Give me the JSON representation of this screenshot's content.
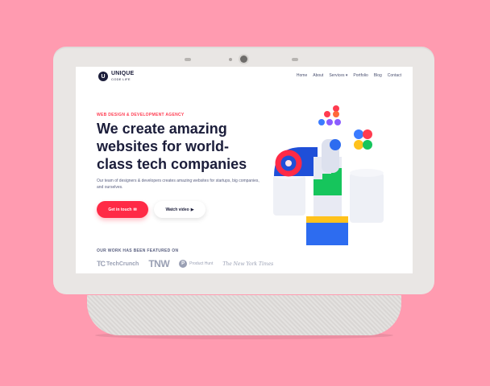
{
  "site": {
    "logo": {
      "mark": "U",
      "line1": "UNIQUE",
      "line2": "CODE LIFE"
    },
    "nav": [
      {
        "label": "Home"
      },
      {
        "label": "About"
      },
      {
        "label": "Services ▾"
      },
      {
        "label": "Portfolio"
      },
      {
        "label": "Blog"
      },
      {
        "label": "Contact"
      }
    ]
  },
  "hero": {
    "eyebrow": "WEB DESIGN & DEVELOPMENT AGENCY",
    "headline": "We create amazing websites for world-class tech companies",
    "subtext": "Our team of designers & developers creates amazing websites for startups, big companies, and ourselves.",
    "primary_button": "Get in touch",
    "primary_button_icon": "✉",
    "secondary_button": "Watch video",
    "secondary_button_icon": "▶"
  },
  "featured": {
    "label": "OUR WORK HAS BEEN FEATURED ON",
    "brands": {
      "techcrunch_mark": "TC",
      "techcrunch": "TechCrunch",
      "tnw": "TNW",
      "producthunt_mark": "P",
      "producthunt": "Product Hunt",
      "nyt": "The New York Times"
    }
  },
  "colors": {
    "background": "#ff9bb0",
    "accent": "#ff2a46",
    "heading": "#1b1d3a",
    "device": "#e9e6e4"
  }
}
